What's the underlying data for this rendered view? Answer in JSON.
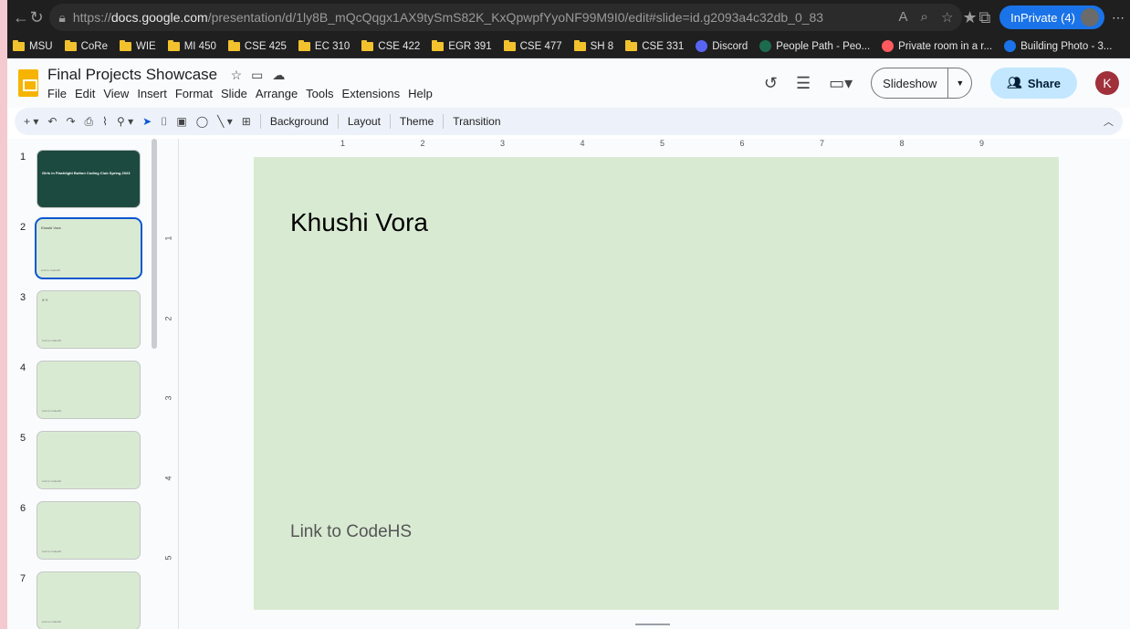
{
  "browser": {
    "url_prefix": "https://",
    "url_host": "docs.google.com",
    "url_path": "/presentation/d/1ly8B_mQcQqgx1AX9tySmS82K_KxQpwpfYyoNF99M9I0/edit#slide=id.g2093a4c32db_0_83",
    "inprivate_label": "InPrivate (4)"
  },
  "bookmarks": [
    {
      "label": "MSU",
      "icon": "folder"
    },
    {
      "label": "CoRe",
      "icon": "folder"
    },
    {
      "label": "WIE",
      "icon": "folder"
    },
    {
      "label": "MI 450",
      "icon": "folder"
    },
    {
      "label": "CSE 425",
      "icon": "folder"
    },
    {
      "label": "EC 310",
      "icon": "folder"
    },
    {
      "label": "CSE 422",
      "icon": "folder"
    },
    {
      "label": "EGR 391",
      "icon": "folder"
    },
    {
      "label": "CSE 477",
      "icon": "folder"
    },
    {
      "label": "SH 8",
      "icon": "folder"
    },
    {
      "label": "CSE 331",
      "icon": "folder"
    },
    {
      "label": "Discord",
      "icon": "discord",
      "color": "#5865f2"
    },
    {
      "label": "People Path - Peo...",
      "icon": "peoplepath",
      "color": "#1d6b4f"
    },
    {
      "label": "Private room in a r...",
      "icon": "airbnb",
      "color": "#ff5a5f"
    },
    {
      "label": "Building Photo - 3...",
      "icon": "fr",
      "color": "#1a73e8"
    }
  ],
  "app": {
    "doc_title": "Final Projects Showcase",
    "menus": [
      "File",
      "Edit",
      "View",
      "Insert",
      "Format",
      "Slide",
      "Arrange",
      "Tools",
      "Extensions",
      "Help"
    ],
    "slideshow_label": "Slideshow",
    "share_label": "Share",
    "user_initial": "K"
  },
  "toolbar": {
    "background": "Background",
    "layout": "Layout",
    "theme": "Theme",
    "transition": "Transition"
  },
  "slides": [
    {
      "num": "1",
      "title": "Girls in Flashlight Button Coding Club Spring 2023",
      "link": "",
      "dark": true
    },
    {
      "num": "2",
      "title": "Khushi Vora",
      "link": "Link to CodeHS",
      "selected": true
    },
    {
      "num": "3",
      "title": "X Y",
      "link": "Link to CodeHS"
    },
    {
      "num": "4",
      "title": "",
      "link": "Link to CodeHS"
    },
    {
      "num": "5",
      "title": "",
      "link": "Link to CodeHS"
    },
    {
      "num": "6",
      "title": "",
      "link": "Link to CodeHS"
    },
    {
      "num": "7",
      "title": "",
      "link": "Link to CodeHS"
    }
  ],
  "ruler": {
    "h": [
      "1",
      "2",
      "3",
      "4",
      "5",
      "6",
      "7",
      "8",
      "9"
    ],
    "v": [
      "1",
      "2",
      "3",
      "4",
      "5"
    ]
  },
  "current_slide": {
    "title": "Khushi Vora",
    "link_text": "Link to CodeHS"
  }
}
